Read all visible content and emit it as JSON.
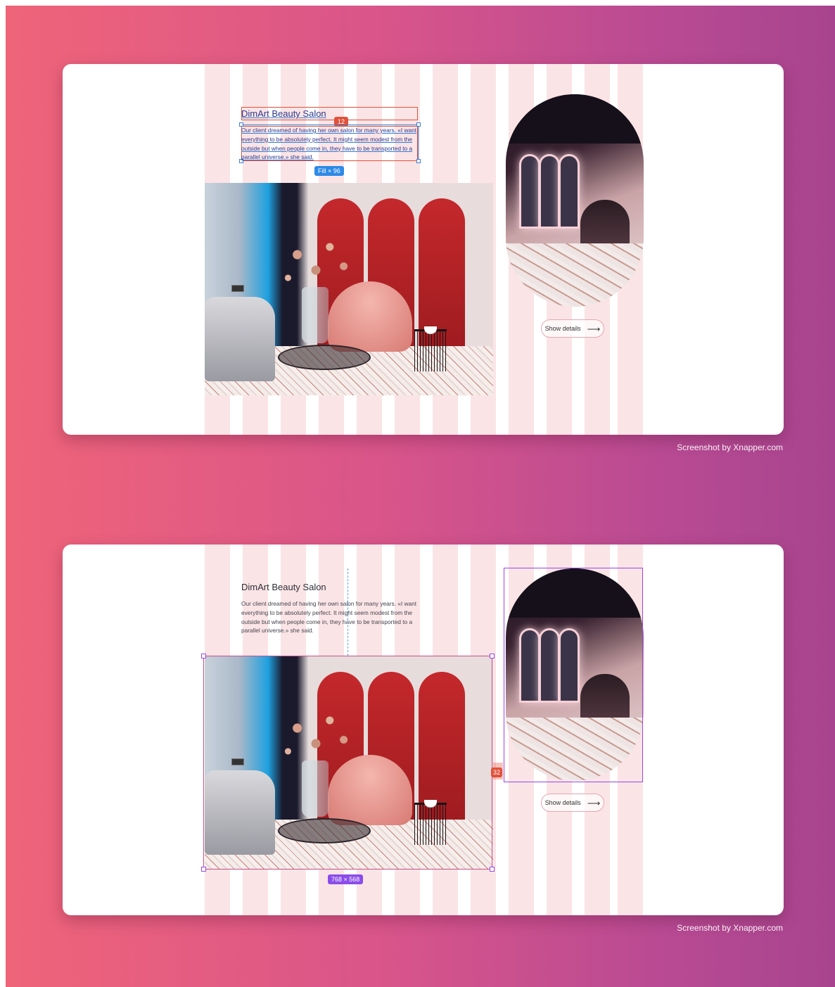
{
  "credit": "Screenshot by Xnapper.com",
  "colors": {
    "accent_red": "#e0523b",
    "accent_blue": "#2e8ae6",
    "accent_purple": "#8b4dea",
    "bg_start": "#ef6479",
    "bg_end": "#a8448f"
  },
  "panel_top": {
    "title": "DimArt Beauty Salon",
    "paragraph": "Our client dreamed of having her own salon for many years. «I want everything to be absolutely perfect. It might seem modest from the outside but when people come in, they have to be transported to a parallel universe.» she said.",
    "gap_badge": "12",
    "size_badge": "Fill × 96",
    "button_label": "Show details",
    "arrow_icon": "arrow-right-icon"
  },
  "panel_bottom": {
    "title": "DimArt Beauty Salon",
    "paragraph": "Our client dreamed of having her own salon for many years. «I want everything to be absolutely perfect. It might seem modest from the outside but when people come in, they have to be transported to a parallel universe.» she said.",
    "gap_badge": "32",
    "size_badge": "768 × 568",
    "button_label": "Show details",
    "arrow_icon": "arrow-right-icon"
  }
}
